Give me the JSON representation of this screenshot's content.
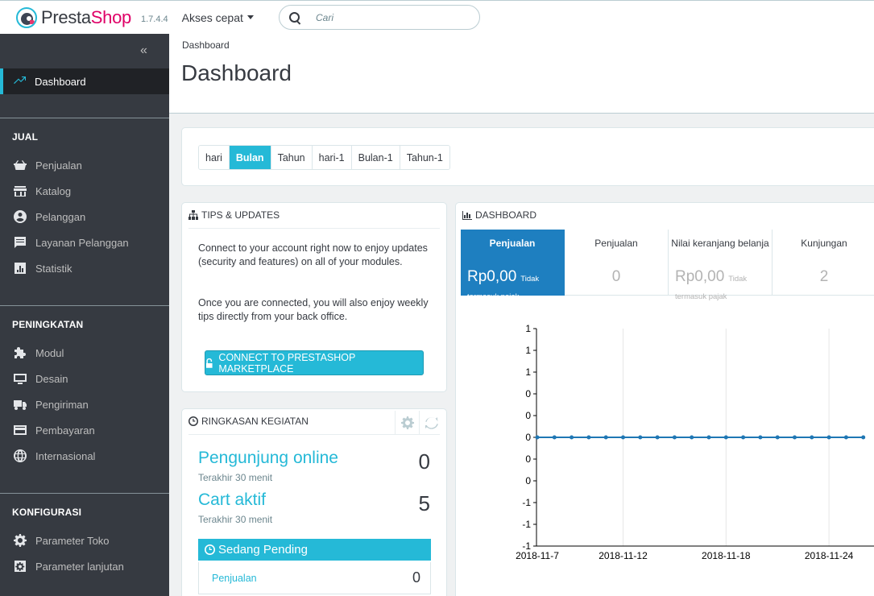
{
  "header": {
    "logo_presta": "Presta",
    "logo_shop": "Shop",
    "version": "1.7.4.4",
    "quick_access": "Akses cepat",
    "search_placeholder": "Cari"
  },
  "sidebar": {
    "collapse_glyph": "«",
    "dashboard": "Dashboard",
    "sections": [
      {
        "title": "JUAL",
        "items": [
          "Penjualan",
          "Katalog",
          "Pelanggan",
          "Layanan Pelanggan",
          "Statistik"
        ]
      },
      {
        "title": "PENINGKATAN",
        "items": [
          "Modul",
          "Desain",
          "Pengiriman",
          "Pembayaran",
          "Internasional"
        ]
      },
      {
        "title": "KONFIGURASI",
        "items": [
          "Parameter Toko",
          "Parameter lanjutan"
        ]
      }
    ]
  },
  "page": {
    "breadcrumb": "Dashboard",
    "title": "Dashboard"
  },
  "periods": {
    "options": [
      "hari",
      "Bulan",
      "Tahun",
      "hari-1",
      "Bulan-1",
      "Tahun-1"
    ],
    "selected": "Bulan"
  },
  "tips": {
    "heading": "TIPS & UPDATES",
    "text1": "Connect to your account right now to enjoy updates (security and features) on all of your modules.",
    "text2": "Once you are connected, you will also enjoy weekly tips directly from your back office.",
    "button": "CONNECT TO PRESTASHOP MARKETPLACE"
  },
  "activity": {
    "heading": "RINGKASAN KEGIATAN",
    "visitors_label": "Pengunjung online",
    "visitors_sub": "Terakhir 30 menit",
    "visitors_value": "0",
    "carts_label": "Cart aktif",
    "carts_sub": "Terakhir 30 menit",
    "carts_value": "5",
    "pending_title": "Sedang Pending",
    "pending_row_label": "Penjualan",
    "pending_row_value": "0"
  },
  "dashboard": {
    "heading": "DASHBOARD",
    "kpis": [
      {
        "title": "Penjualan",
        "value": "Rp0,00",
        "suffix": "Tidak termasuk pajak",
        "active": true
      },
      {
        "title": "Penjualan",
        "value": "0",
        "suffix": "",
        "active": false
      },
      {
        "title": "Nilai keranjang belanja",
        "value": "Rp0,00",
        "suffix": "Tidak termasuk pajak",
        "active": false
      },
      {
        "title": "Kunjungan",
        "value": "2",
        "suffix": "",
        "active": false
      }
    ]
  },
  "chart_data": {
    "type": "line",
    "title": "",
    "xlabel": "",
    "ylabel": "",
    "x_tick_labels": [
      "2018-11-7",
      "2018-11-12",
      "2018-11-18",
      "2018-11-24"
    ],
    "y_tick_labels": [
      "1",
      "1",
      "1",
      "0",
      "0",
      "0",
      "0",
      "0",
      "-1",
      "-1",
      "-1"
    ],
    "ylim": [
      -1,
      1
    ],
    "grid": true,
    "series": [
      {
        "color": "#1f77b4",
        "x": [
          "2018-11-7",
          "2018-11-8",
          "2018-11-9",
          "2018-11-10",
          "2018-11-11",
          "2018-11-12",
          "2018-11-13",
          "2018-11-14",
          "2018-11-15",
          "2018-11-16",
          "2018-11-17",
          "2018-11-18",
          "2018-11-19",
          "2018-11-20",
          "2018-11-21",
          "2018-11-22",
          "2018-11-23",
          "2018-11-24",
          "2018-11-25",
          "2018-11-26"
        ],
        "values": [
          0,
          0,
          0,
          0,
          0,
          0,
          0,
          0,
          0,
          0,
          0,
          0,
          0,
          0,
          0,
          0,
          0,
          0,
          0,
          0
        ]
      }
    ]
  }
}
